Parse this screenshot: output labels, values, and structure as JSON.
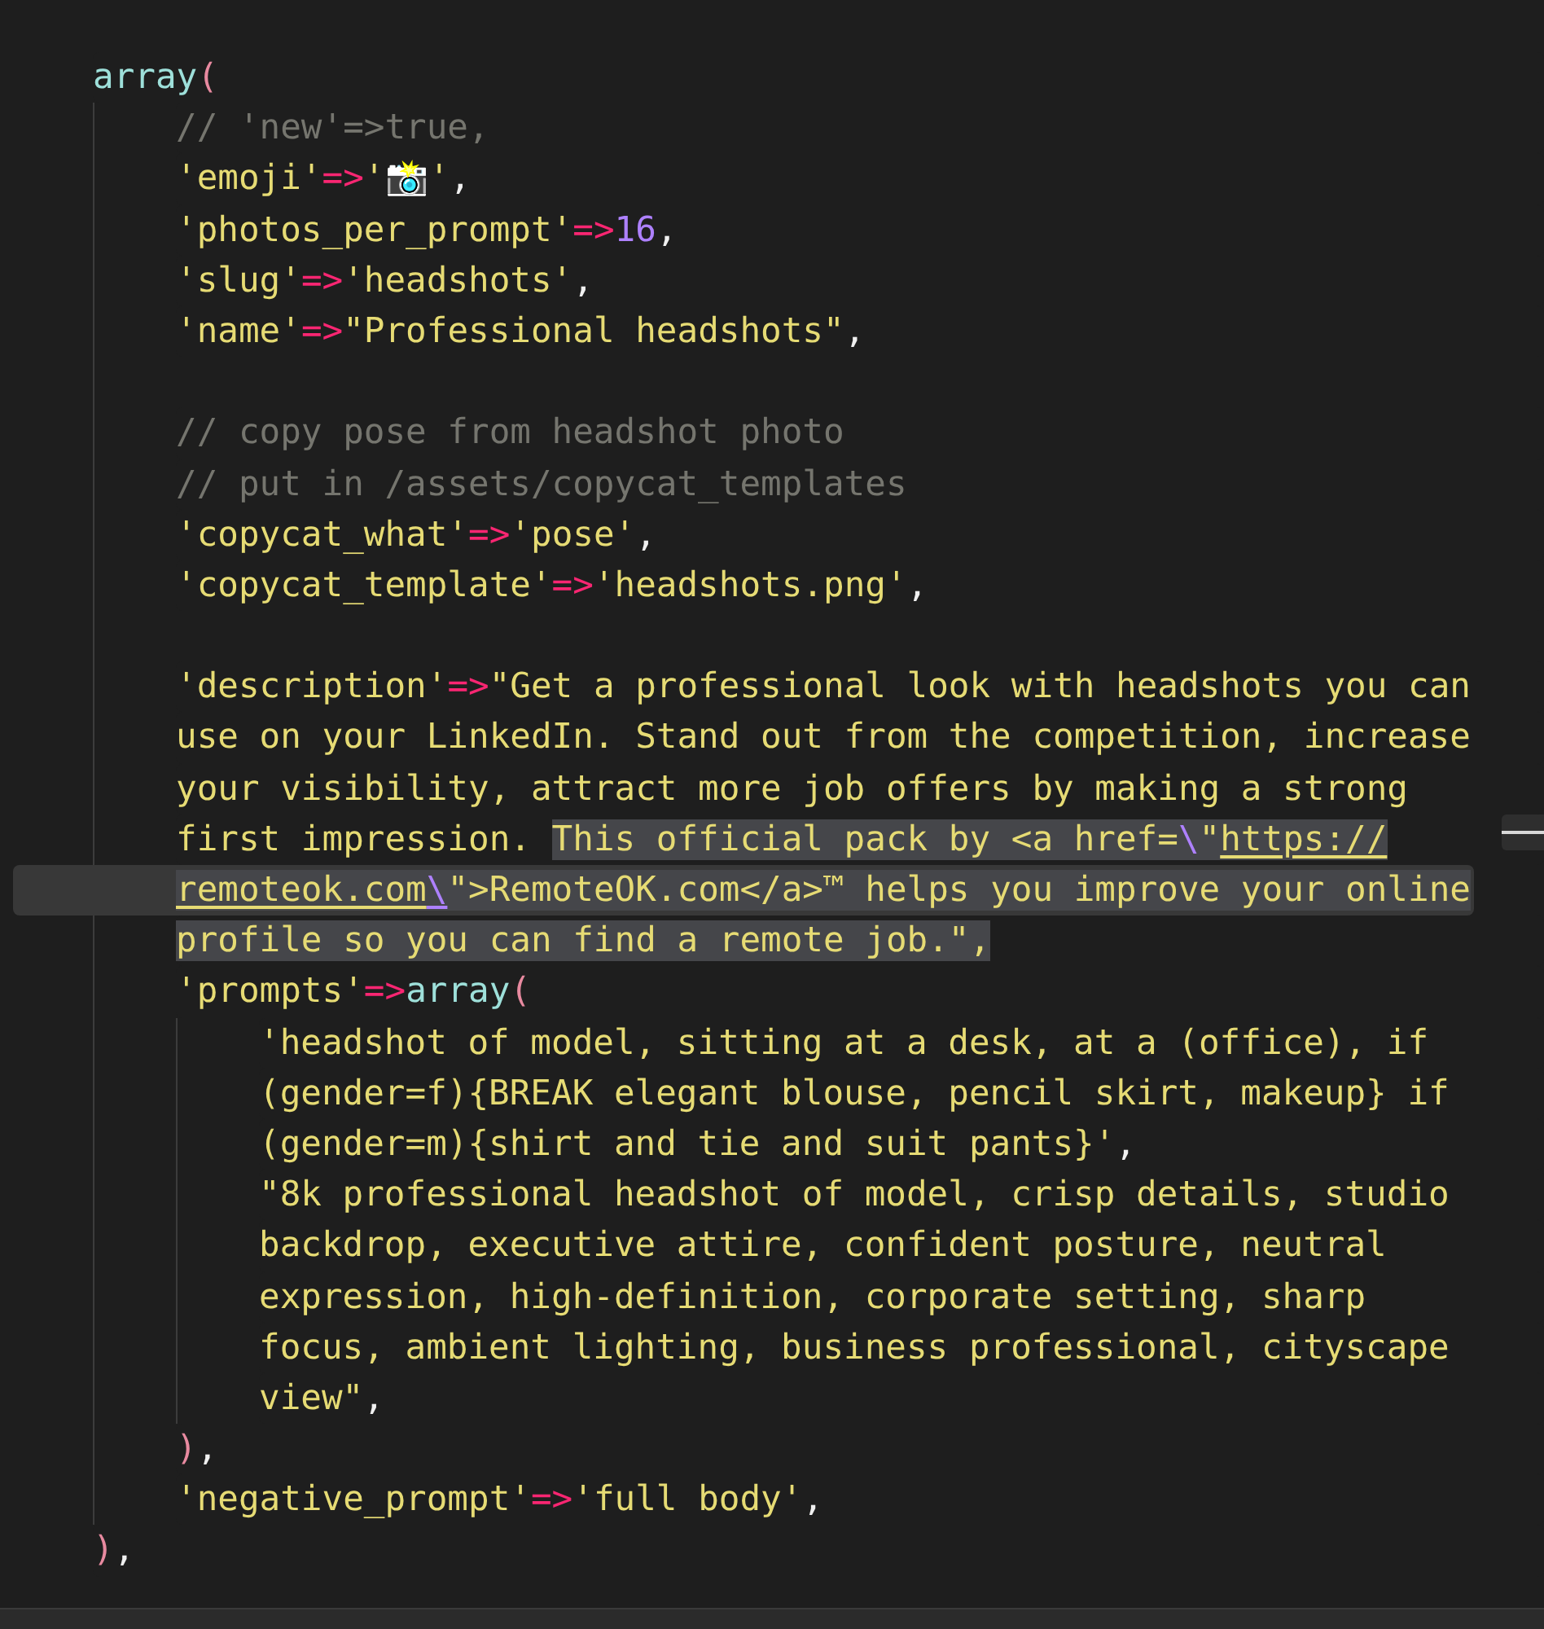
{
  "code": [
    {
      "kind": "line",
      "current": false,
      "tokens": [
        {
          "text": "array",
          "kind": "fn",
          "selected": false
        },
        {
          "text": "(",
          "kind": "paren",
          "selected": false
        }
      ],
      "children": [
        {
          "kind": "line",
          "current": false,
          "tokens": [
            {
              "text": "// 'new'=>true,",
              "kind": "comment",
              "selected": false
            }
          ]
        },
        {
          "kind": "line",
          "current": false,
          "tokens": [
            {
              "text": "'emoji'",
              "kind": "str",
              "selected": false
            },
            {
              "text": "=>",
              "kind": "op",
              "selected": false
            },
            {
              "text": "'",
              "kind": "str",
              "selected": false
            },
            {
              "text": "📸",
              "kind": "emoji",
              "selected": false
            },
            {
              "text": "'",
              "kind": "str",
              "selected": false
            },
            {
              "text": ",",
              "kind": "punct",
              "selected": false
            }
          ]
        },
        {
          "kind": "line",
          "current": false,
          "tokens": [
            {
              "text": "'photos_per_prompt'",
              "kind": "str",
              "selected": false
            },
            {
              "text": "=>",
              "kind": "op",
              "selected": false
            },
            {
              "text": "16",
              "kind": "num",
              "selected": false
            },
            {
              "text": ",",
              "kind": "punct",
              "selected": false
            }
          ]
        },
        {
          "kind": "line",
          "current": false,
          "tokens": [
            {
              "text": "'slug'",
              "kind": "str",
              "selected": false
            },
            {
              "text": "=>",
              "kind": "op",
              "selected": false
            },
            {
              "text": "'headshots'",
              "kind": "str",
              "selected": false
            },
            {
              "text": ",",
              "kind": "punct",
              "selected": false
            }
          ]
        },
        {
          "kind": "line",
          "current": false,
          "tokens": [
            {
              "text": "'name'",
              "kind": "str",
              "selected": false
            },
            {
              "text": "=>",
              "kind": "op",
              "selected": false
            },
            {
              "text": "\"Professional headshots\"",
              "kind": "str",
              "selected": false
            },
            {
              "text": ",",
              "kind": "punct",
              "selected": false
            }
          ]
        },
        {
          "kind": "blank"
        },
        {
          "kind": "line",
          "current": false,
          "tokens": [
            {
              "text": "// copy pose from headshot photo",
              "kind": "comment",
              "selected": false
            }
          ]
        },
        {
          "kind": "line",
          "current": false,
          "tokens": [
            {
              "text": "// put in /assets/copycat_templates",
              "kind": "comment",
              "selected": false
            }
          ]
        },
        {
          "kind": "line",
          "current": false,
          "tokens": [
            {
              "text": "'copycat_what'",
              "kind": "str",
              "selected": false
            },
            {
              "text": "=>",
              "kind": "op",
              "selected": false
            },
            {
              "text": "'pose'",
              "kind": "str",
              "selected": false
            },
            {
              "text": ",",
              "kind": "punct",
              "selected": false
            }
          ]
        },
        {
          "kind": "line",
          "current": false,
          "tokens": [
            {
              "text": "'copycat_template'",
              "kind": "str",
              "selected": false
            },
            {
              "text": "=>",
              "kind": "op",
              "selected": false
            },
            {
              "text": "'headshots.png'",
              "kind": "str",
              "selected": false
            },
            {
              "text": ",",
              "kind": "punct",
              "selected": false
            }
          ]
        },
        {
          "kind": "blank"
        },
        {
          "kind": "line",
          "current": false,
          "tokens": [
            {
              "text": "'description'",
              "kind": "str",
              "selected": false
            },
            {
              "text": "=>",
              "kind": "op",
              "selected": false
            },
            {
              "text": "\"Get a professional look with headshots you can",
              "kind": "str",
              "selected": false
            }
          ]
        },
        {
          "kind": "line",
          "current": false,
          "tokens": [
            {
              "text": "use on your LinkedIn. Stand out from the competition, increase",
              "kind": "str",
              "selected": false
            }
          ]
        },
        {
          "kind": "line",
          "current": false,
          "tokens": [
            {
              "text": "your visibility, attract more job offers by making a strong",
              "kind": "str",
              "selected": false
            }
          ]
        },
        {
          "kind": "line",
          "current": false,
          "tokens": [
            {
              "text": "first impression. ",
              "kind": "str",
              "selected": false
            },
            {
              "text": "This official pack by <a href=",
              "kind": "str",
              "selected": true
            },
            {
              "text": "\\",
              "kind": "esc",
              "selected": true
            },
            {
              "text": "\"",
              "kind": "str",
              "selected": true
            },
            {
              "text": "https://",
              "kind": "link",
              "selected": true
            }
          ]
        },
        {
          "kind": "line",
          "current": true,
          "tokens": [
            {
              "text": "remoteok.com",
              "kind": "link",
              "selected": true
            },
            {
              "text": "\\",
              "kind": "esclink",
              "selected": true
            },
            {
              "text": "\">RemoteOK.com</a>™ helps you improve your online",
              "kind": "str",
              "selected": true
            }
          ]
        },
        {
          "kind": "line",
          "current": false,
          "tokens": [
            {
              "text": "profile so you can find a remote job.\",",
              "kind": "str",
              "selected": true
            }
          ]
        },
        {
          "kind": "line",
          "current": false,
          "tokens": [
            {
              "text": "'prompts'",
              "kind": "str",
              "selected": false
            },
            {
              "text": "=>",
              "kind": "op",
              "selected": false
            },
            {
              "text": "array",
              "kind": "fn",
              "selected": false
            },
            {
              "text": "(",
              "kind": "paren",
              "selected": false
            }
          ],
          "children": [
            {
              "kind": "line",
              "current": false,
              "tokens": [
                {
                  "text": "'headshot of model, sitting at a desk, at a (office), if",
                  "kind": "str",
                  "selected": false
                }
              ]
            },
            {
              "kind": "line",
              "current": false,
              "tokens": [
                {
                  "text": "(gender=f){BREAK elegant blouse, pencil skirt, makeup} if",
                  "kind": "str",
                  "selected": false
                }
              ]
            },
            {
              "kind": "line",
              "current": false,
              "tokens": [
                {
                  "text": "(gender=m){shirt and tie and suit pants}'",
                  "kind": "str",
                  "selected": false
                },
                {
                  "text": ",",
                  "kind": "punct",
                  "selected": false
                }
              ]
            },
            {
              "kind": "line",
              "current": false,
              "tokens": [
                {
                  "text": "\"8k professional headshot of model, crisp details, studio",
                  "kind": "str",
                  "selected": false
                }
              ]
            },
            {
              "kind": "line",
              "current": false,
              "tokens": [
                {
                  "text": "backdrop, executive attire, confident posture, neutral",
                  "kind": "str",
                  "selected": false
                }
              ]
            },
            {
              "kind": "line",
              "current": false,
              "tokens": [
                {
                  "text": "expression, high-definition, corporate setting, sharp",
                  "kind": "str",
                  "selected": false
                }
              ]
            },
            {
              "kind": "line",
              "current": false,
              "tokens": [
                {
                  "text": "focus, ambient lighting, business professional, cityscape",
                  "kind": "str",
                  "selected": false
                }
              ]
            },
            {
              "kind": "line",
              "current": false,
              "tokens": [
                {
                  "text": "view\"",
                  "kind": "str",
                  "selected": false
                },
                {
                  "text": ",",
                  "kind": "punct",
                  "selected": false
                }
              ]
            }
          ]
        },
        {
          "kind": "line",
          "current": false,
          "tokens": [
            {
              "text": ")",
              "kind": "paren",
              "selected": false
            },
            {
              "text": ",",
              "kind": "punct",
              "selected": false
            }
          ]
        },
        {
          "kind": "line",
          "current": false,
          "tokens": [
            {
              "text": "'negative_prompt'",
              "kind": "str",
              "selected": false
            },
            {
              "text": "=>",
              "kind": "op",
              "selected": false
            },
            {
              "text": "'full body'",
              "kind": "str",
              "selected": false
            },
            {
              "text": ",",
              "kind": "punct",
              "selected": false
            }
          ]
        }
      ]
    },
    {
      "kind": "line",
      "current": false,
      "tokens": [
        {
          "text": ")",
          "kind": "paren",
          "selected": false
        },
        {
          "text": ",",
          "kind": "punct",
          "selected": false
        }
      ]
    }
  ]
}
